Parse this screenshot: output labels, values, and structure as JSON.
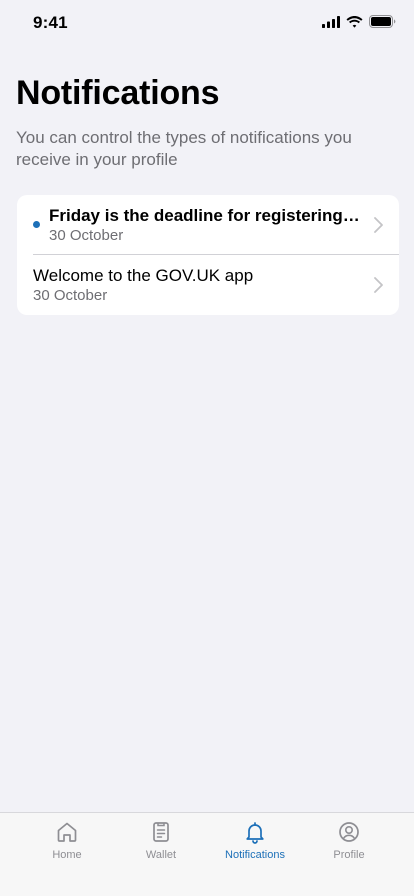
{
  "status_bar": {
    "time": "9:41",
    "icons": [
      "cellular-signal-icon",
      "wifi-icon",
      "battery-icon"
    ]
  },
  "header": {
    "title": "Notifications",
    "subtitle": "You can control the types of notifications you receive in your profile"
  },
  "notifications": [
    {
      "title": "Friday is the deadline for registering…",
      "date": "30 October",
      "unread": true,
      "icon": "chevron-right-icon"
    },
    {
      "title": "Welcome to the GOV.UK app",
      "date": "30 October",
      "unread": false,
      "icon": "chevron-right-icon"
    }
  ],
  "tab_bar": {
    "tabs": [
      {
        "label": "Home",
        "icon": "home-icon",
        "active": false
      },
      {
        "label": "Wallet",
        "icon": "wallet-icon",
        "active": false
      },
      {
        "label": "Notifications",
        "icon": "bell-icon",
        "active": true
      },
      {
        "label": "Profile",
        "icon": "profile-icon",
        "active": false
      }
    ]
  },
  "colors": {
    "accent": "#1d70b8",
    "background": "#f2f2f7",
    "secondary_text": "#6e6e73",
    "inactive_tab": "#8e8e93"
  }
}
